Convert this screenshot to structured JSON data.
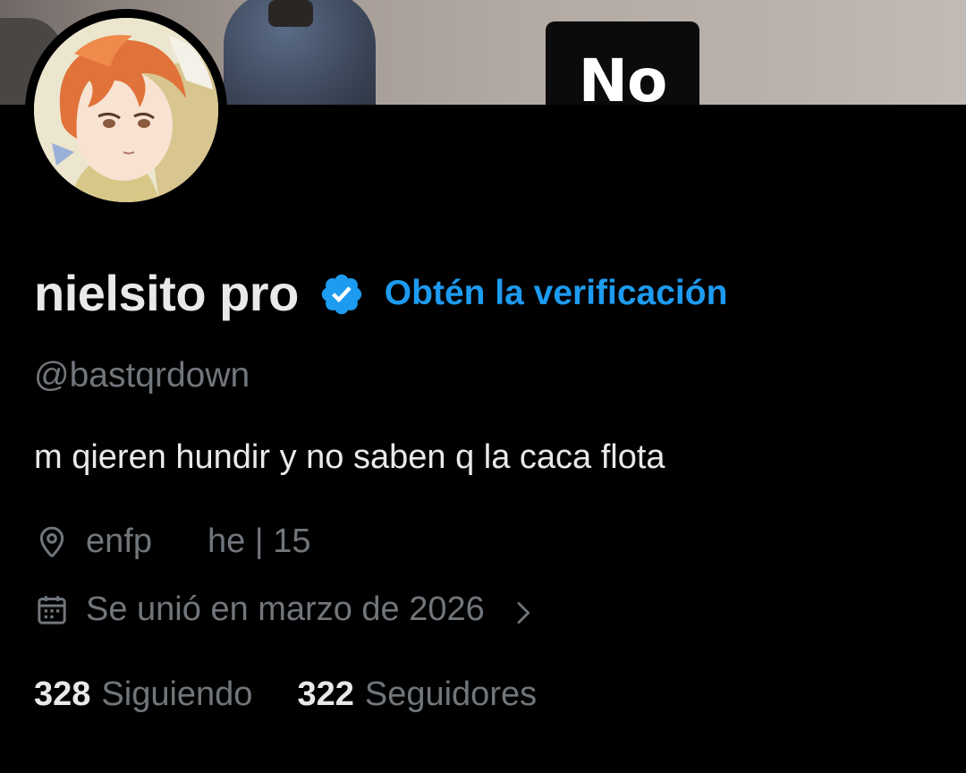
{
  "banner": {
    "sign_text": "No"
  },
  "profile": {
    "display_name": "nielsito pro",
    "verified_icon": "verified-badge-icon",
    "get_verified_label": "Obtén la verificación",
    "handle": "@bastqrdown",
    "bio": "m qieren hundir y no saben q la caca flota",
    "location_icon": "location-pin-icon",
    "location": "enfp",
    "pronouns": "he | 15",
    "joined_icon": "calendar-icon",
    "joined": "Se unió en marzo de 2026",
    "following_count": "328",
    "following_label": "Siguiendo",
    "followers_count": "322",
    "followers_label": "Seguidores"
  },
  "colors": {
    "background": "#000000",
    "text_primary": "#e7e9ea",
    "text_secondary": "#71767b",
    "accent": "#1d9bf0"
  }
}
